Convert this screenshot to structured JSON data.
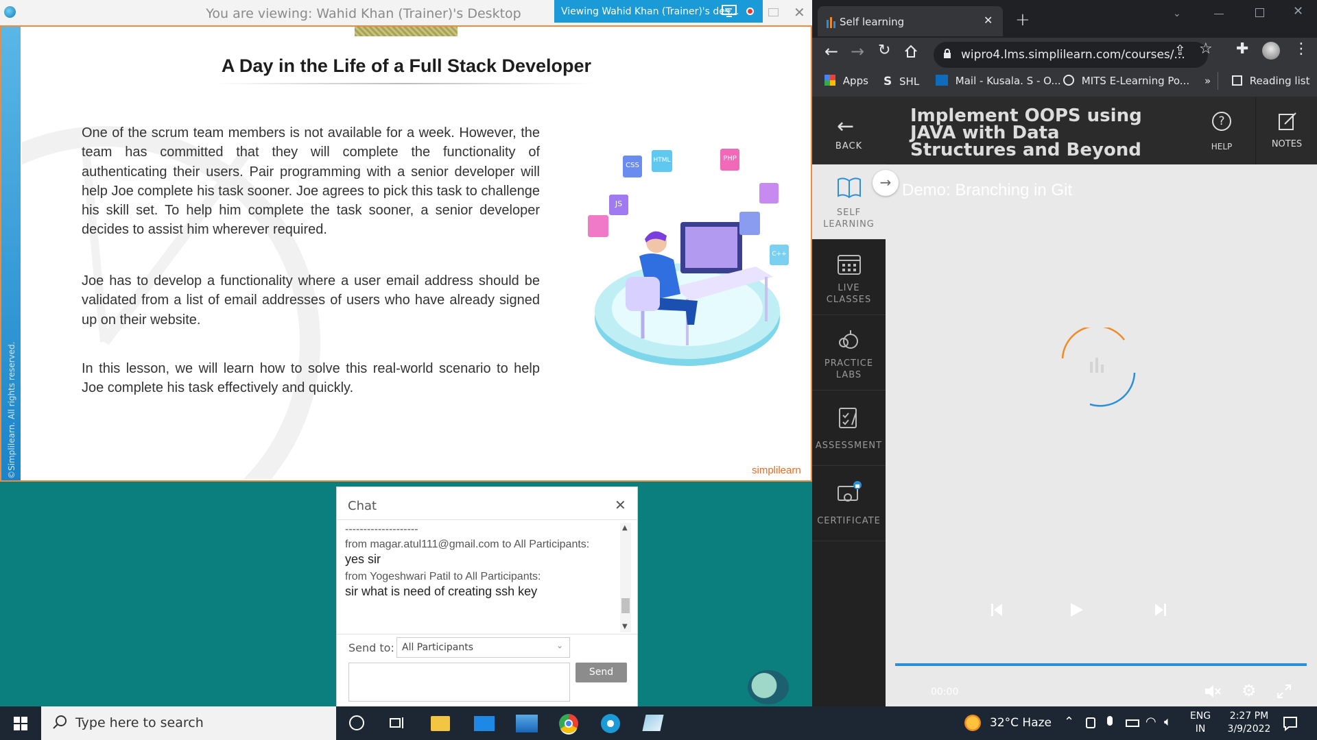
{
  "webex": {
    "title": "You are viewing: Wahid Khan (Trainer)'s Desktop",
    "tab_label": "Viewing Wahid Khan (Trainer)'s des..."
  },
  "slide": {
    "copyright": "©Simplilearn. All rights reserved.",
    "title": "A Day in the Life of a Full Stack Developer",
    "paragraphs": [
      "One of the scrum team members is not available for a week. However, the team has committed that they will complete the functionality of authenticating their users. Pair programming with a senior developer will help Joe complete his task sooner. Joe agrees to pick this task to challenge his skill set. To help him complete the task sooner, a senior developer decides to assist him wherever required.",
      "Joe has to develop a functionality where a user email address should be validated from a list of email addresses of users who have already signed up on their website.",
      "In this lesson, we will learn how to solve this real-world scenario to help Joe complete his task effectively and quickly."
    ],
    "logo": "simplilearn",
    "badges": [
      "CSS",
      "HTML",
      "PHP",
      "JS",
      "C++"
    ]
  },
  "chat": {
    "title": "Chat",
    "divider": "--------------------",
    "messages": [
      {
        "from": "from magar.atul111@gmail.com to All Participants:",
        "text": "yes sir"
      },
      {
        "from": "from Yogeshwari Patil to All Participants:",
        "text": "sir what is need of creating ssh key"
      }
    ],
    "send_to_label": "Send to:",
    "send_to_value": "All Participants",
    "send_label": "Send"
  },
  "browser": {
    "tab_title": "Self learning",
    "url": "wipro4.lms.simplilearn.com/courses/...",
    "bookmarks": [
      "Apps",
      "SHL",
      "Mail - Kusala. S - O...",
      "MITS E-Learning Po..."
    ],
    "more_bookmarks": "»",
    "reading_list": "Reading list"
  },
  "lms": {
    "back_label": "BACK",
    "course_title": "Implement OOPS using JAVA with Data Structures and Beyond",
    "help_label": "HELP",
    "notes_label": "NOTES",
    "sidebar": [
      {
        "label": "SELF\nLEARNING"
      },
      {
        "label": "LIVE\nCLASSES"
      },
      {
        "label": "PRACTICE\nLABS"
      },
      {
        "label": "ASSESSMENT"
      },
      {
        "label": "CERTIFICATE"
      }
    ],
    "demo_title": "Demo: Branching in Git",
    "time": "00:00",
    "accent_orange": "#f08a24",
    "accent_blue": "#2a8fd8"
  },
  "taskbar": {
    "search_placeholder": "Type here to search",
    "weather": "32°C  Haze",
    "lang": "ENG",
    "region": "IN",
    "time": "2:27 PM",
    "date": "3/9/2022"
  }
}
